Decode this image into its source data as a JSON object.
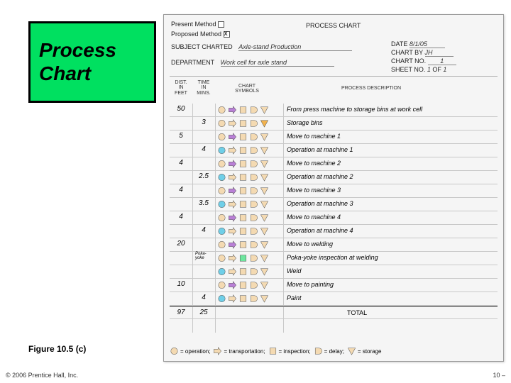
{
  "title": "Process Chart",
  "figure_label": "Figure 10.5 (c)",
  "copyright": "© 2006 Prentice Hall, Inc.",
  "slide_num": "10 –",
  "header": {
    "present_method_label": "Present Method",
    "proposed_method_label": "Proposed Method",
    "chart_title": "PROCESS CHART",
    "subject_label": "SUBJECT CHARTED",
    "subject_value": "Axle-stand Production",
    "date_label": "DATE",
    "date_value": "8/1/05",
    "chart_by_label": "CHART BY",
    "chart_by_value": "JH",
    "chart_no_label": "CHART NO.",
    "chart_no_value": "1",
    "dept_label": "DEPARTMENT",
    "dept_value": "Work cell for axle stand",
    "sheet_label": "SHEET NO.",
    "sheet_value": "1",
    "of_label": "OF",
    "of_value": "1"
  },
  "columns": {
    "dist": "DIST.\nIN\nFEET",
    "time": "TIME\nIN\nMINS.",
    "symbols": "CHART\nSYMBOLS",
    "desc": "PROCESS DESCRIPTION"
  },
  "rows": [
    {
      "dist": "50",
      "time": "",
      "active": "transport",
      "desc": "From press machine to storage bins at work cell"
    },
    {
      "dist": "",
      "time": "3",
      "active": "storage",
      "desc": "Storage bins"
    },
    {
      "dist": "5",
      "time": "",
      "active": "transport",
      "desc": "Move to machine 1"
    },
    {
      "dist": "",
      "time": "4",
      "active": "operation",
      "desc": "Operation at machine 1"
    },
    {
      "dist": "4",
      "time": "",
      "active": "transport",
      "desc": "Move to machine 2"
    },
    {
      "dist": "",
      "time": "2.5",
      "active": "operation",
      "desc": "Operation at machine 2"
    },
    {
      "dist": "4",
      "time": "",
      "active": "transport",
      "desc": "Move to machine 3"
    },
    {
      "dist": "",
      "time": "3.5",
      "active": "operation",
      "desc": "Operation at machine 3"
    },
    {
      "dist": "4",
      "time": "",
      "active": "transport",
      "desc": "Move to machine 4"
    },
    {
      "dist": "",
      "time": "4",
      "active": "operation",
      "desc": "Operation at machine 4"
    },
    {
      "dist": "20",
      "time": "",
      "active": "transport",
      "desc": "Move to welding"
    },
    {
      "dist": "",
      "time": "",
      "active": "inspect",
      "desc": "Poka-yoke inspection at welding",
      "poka": "Poka-yoke"
    },
    {
      "dist": "",
      "time": "",
      "active": "operation",
      "desc": "Weld"
    },
    {
      "dist": "10",
      "time": "",
      "active": "transport",
      "desc": "Move to painting"
    },
    {
      "dist": "",
      "time": "4",
      "active": "operation",
      "desc": "Paint"
    }
  ],
  "totals": {
    "dist": "97",
    "time": "25",
    "label": "TOTAL"
  },
  "legend": {
    "operation": "= operation;",
    "transport": "= transportation;",
    "inspect": "= inspection;",
    "delay": "= delay;",
    "storage": "= storage"
  },
  "symbols": [
    "operation",
    "transport",
    "inspect",
    "delay",
    "storage"
  ]
}
